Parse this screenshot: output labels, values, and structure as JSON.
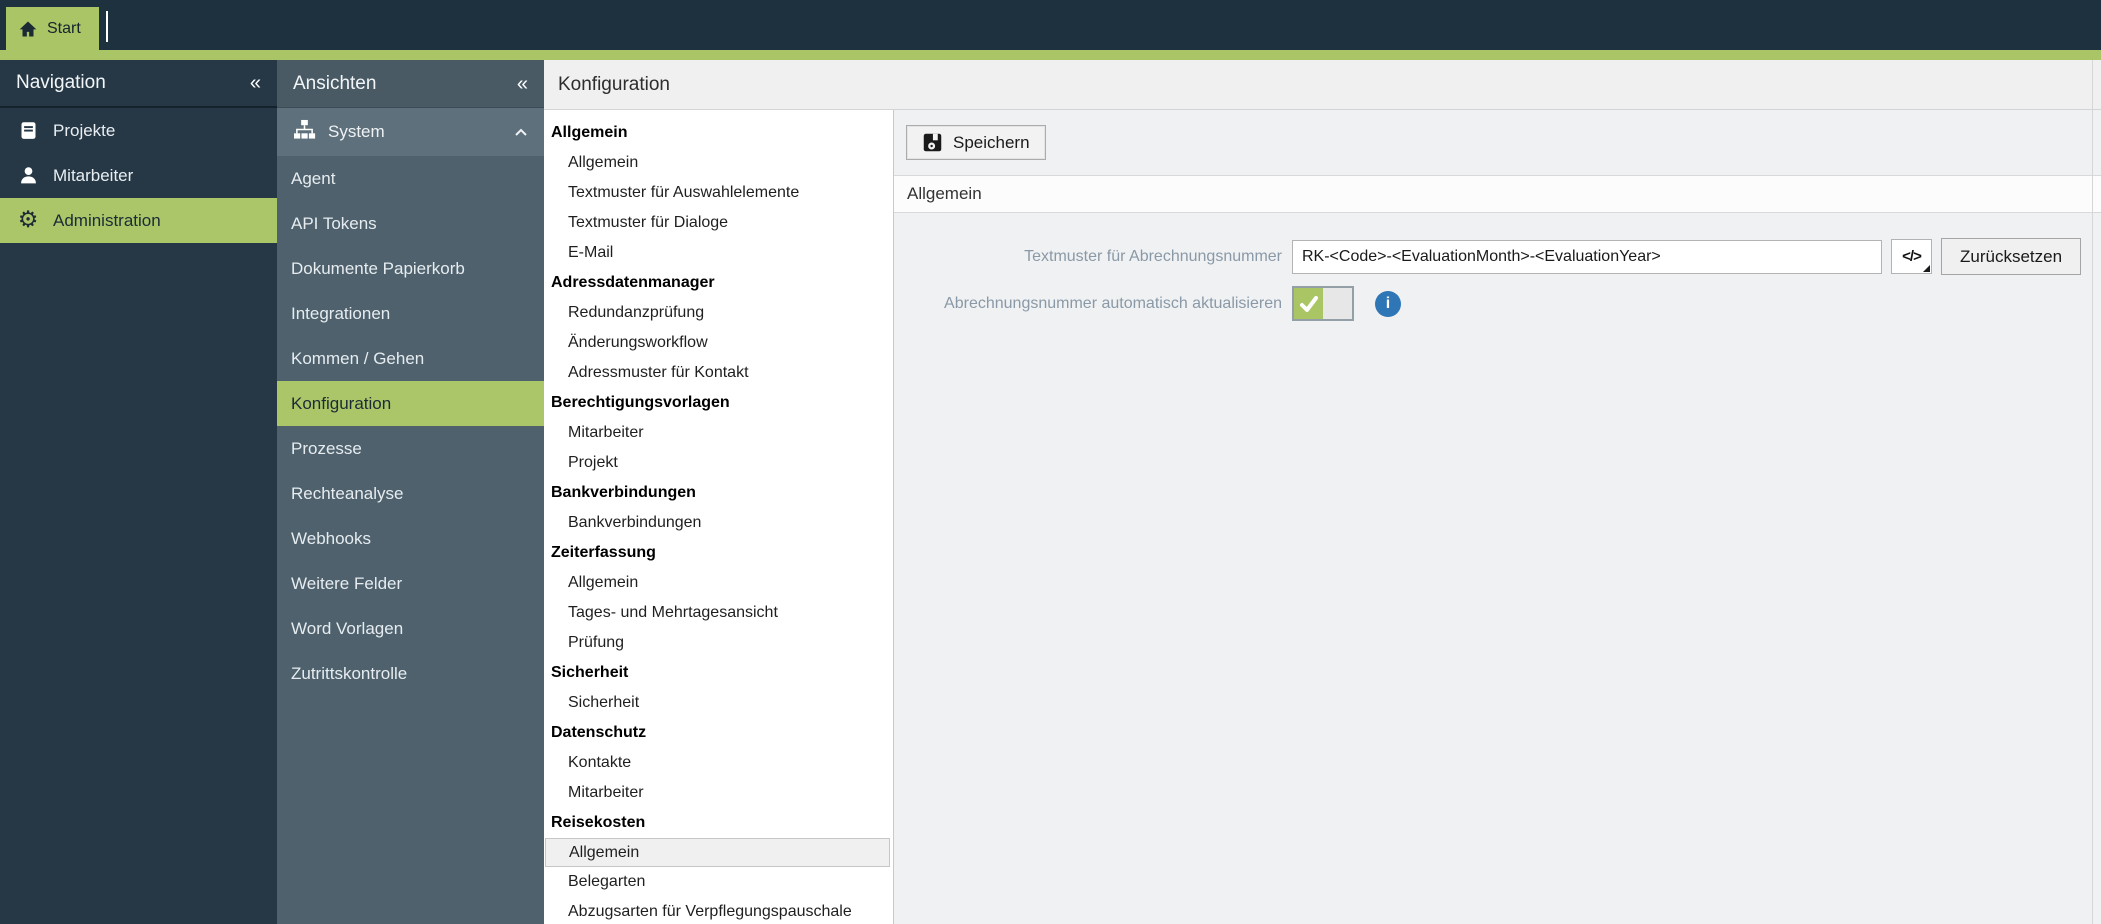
{
  "topbar": {
    "tab": "Start"
  },
  "navigation": {
    "title": "Navigation",
    "collapse_icon": "«",
    "items": [
      {
        "label": "Projekte",
        "icon": "book-icon",
        "active": false
      },
      {
        "label": "Mitarbeiter",
        "icon": "person-icon",
        "active": false
      },
      {
        "label": "Administration",
        "icon": "gear-icon",
        "active": true
      }
    ]
  },
  "views": {
    "title": "Ansichten",
    "collapse_icon": "«",
    "group": {
      "label": "System",
      "icon": "sitemap-icon",
      "expanded": true
    },
    "items": [
      "Agent",
      "API Tokens",
      "Dokumente Papierkorb",
      "Integrationen",
      "Kommen / Gehen",
      "Konfiguration",
      "Prozesse",
      "Rechteanalyse",
      "Webhooks",
      "Weitere Felder",
      "Word Vorlagen",
      "Zutrittskontrolle"
    ],
    "active_item": "Konfiguration"
  },
  "page": {
    "title": "Konfiguration"
  },
  "tree": {
    "items": [
      {
        "label": "Allgemein",
        "type": "header"
      },
      {
        "label": "Allgemein",
        "type": "item"
      },
      {
        "label": "Textmuster für Auswahlelemente",
        "type": "item"
      },
      {
        "label": "Textmuster für Dialoge",
        "type": "item"
      },
      {
        "label": "E-Mail",
        "type": "item"
      },
      {
        "label": "Adressdatenmanager",
        "type": "header"
      },
      {
        "label": "Redundanzprüfung",
        "type": "item"
      },
      {
        "label": "Änderungsworkflow",
        "type": "item"
      },
      {
        "label": "Adressmuster für Kontakt",
        "type": "item"
      },
      {
        "label": "Berechtigungsvorlagen",
        "type": "header"
      },
      {
        "label": "Mitarbeiter",
        "type": "item"
      },
      {
        "label": "Projekt",
        "type": "item"
      },
      {
        "label": "Bankverbindungen",
        "type": "header"
      },
      {
        "label": "Bankverbindungen",
        "type": "item"
      },
      {
        "label": "Zeiterfassung",
        "type": "header"
      },
      {
        "label": "Allgemein",
        "type": "item"
      },
      {
        "label": "Tages- und Mehrtagesansicht",
        "type": "item"
      },
      {
        "label": "Prüfung",
        "type": "item"
      },
      {
        "label": "Sicherheit",
        "type": "header"
      },
      {
        "label": "Sicherheit",
        "type": "item"
      },
      {
        "label": "Datenschutz",
        "type": "header"
      },
      {
        "label": "Kontakte",
        "type": "item"
      },
      {
        "label": "Mitarbeiter",
        "type": "item"
      },
      {
        "label": "Reisekosten",
        "type": "header"
      },
      {
        "label": "Allgemein",
        "type": "item",
        "selected": true
      },
      {
        "label": "Belegarten",
        "type": "item"
      },
      {
        "label": "Abzugsarten für Verpflegungspauschale",
        "type": "item"
      }
    ]
  },
  "main": {
    "save_label": "Speichern",
    "section_title": "Allgemein",
    "form": {
      "pattern_label": "Textmuster für Abrechnungsnummer",
      "pattern_value": "RK-<Code>-<EvaluationMonth>-<EvaluationYear>",
      "code_button_label": "</>",
      "reset_label": "Zurücksetzen",
      "auto_update_label": "Abrechnungsnummer automatisch aktualisieren",
      "auto_update_checked": true,
      "info_glyph": "i"
    }
  },
  "colors": {
    "accent_green": "#a9c566",
    "topbar_dark": "#1e313f",
    "nav_panel": "#263845",
    "views_panel": "#4e616d",
    "info_blue": "#2e76b5"
  }
}
